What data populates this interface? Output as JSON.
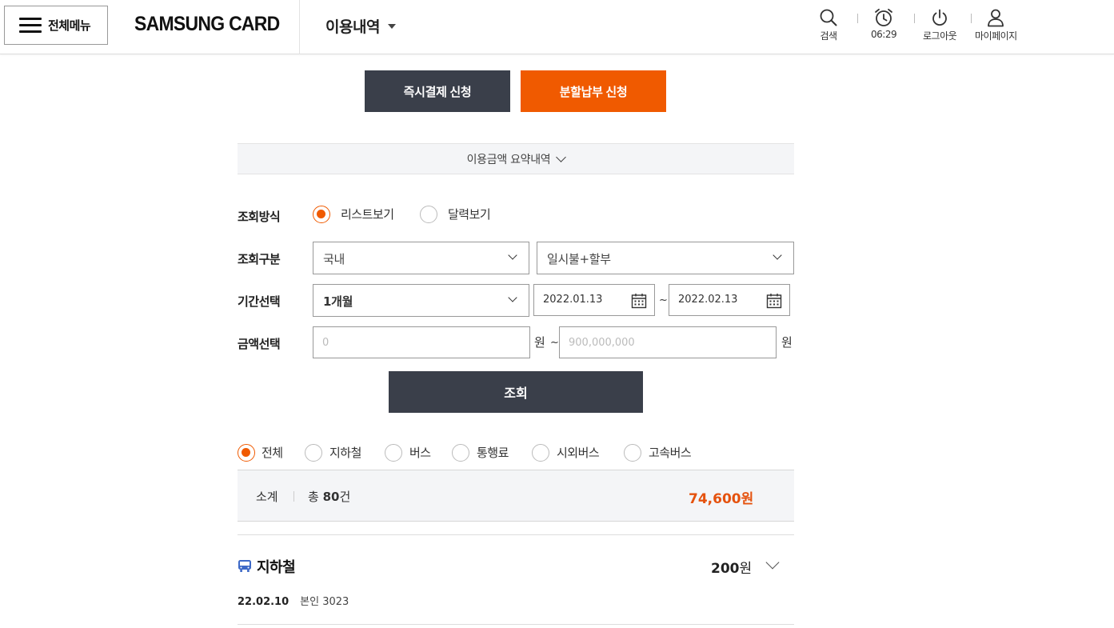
{
  "header": {
    "menu_label": "전체메뉴",
    "logo": "SAMSUNG CARD",
    "page_title": "이용내역",
    "utils": [
      {
        "icon": "search-icon",
        "label": "검색"
      },
      {
        "icon": "alarm-clock-icon",
        "label": "06:29"
      },
      {
        "icon": "power-icon",
        "label": "로그아웃"
      },
      {
        "icon": "user-icon",
        "label": "마이페이지"
      }
    ]
  },
  "actions": {
    "instant_pay": "즉시결제 신청",
    "installment": "분할납부 신청"
  },
  "summary_toggle": "이용금액 요약내역",
  "form": {
    "view_method": {
      "label": "조회방식",
      "options": [
        "리스트보기",
        "달력보기"
      ],
      "selected": "리스트보기"
    },
    "category": {
      "label": "조회구분",
      "region": "국내",
      "type": "일시불+할부"
    },
    "period": {
      "label": "기간선택",
      "range": "1개월",
      "start": "2022.01.13",
      "tilde": "~",
      "end": "2022.02.13"
    },
    "amount": {
      "label": "금액선택",
      "min_placeholder": "0",
      "max_placeholder": "900,000,000",
      "unit": "원",
      "tilde": "~"
    },
    "submit": "조회"
  },
  "filters": {
    "options": [
      "전체",
      "지하철",
      "버스",
      "통행료",
      "시외버스",
      "고속버스"
    ],
    "selected": "전체"
  },
  "subtotal": {
    "label": "소계",
    "count_prefix": "총",
    "count": "80",
    "count_suffix": "건",
    "amount": "74,600",
    "amount_unit": "원"
  },
  "items": [
    {
      "icon": "bus-icon",
      "title": "지하철",
      "amount": "200",
      "amount_unit": "원",
      "date": "22.02.10",
      "owner": "본인 3023"
    }
  ],
  "colors": {
    "accent": "#f05a00",
    "dark_button": "#3a3f4a"
  }
}
